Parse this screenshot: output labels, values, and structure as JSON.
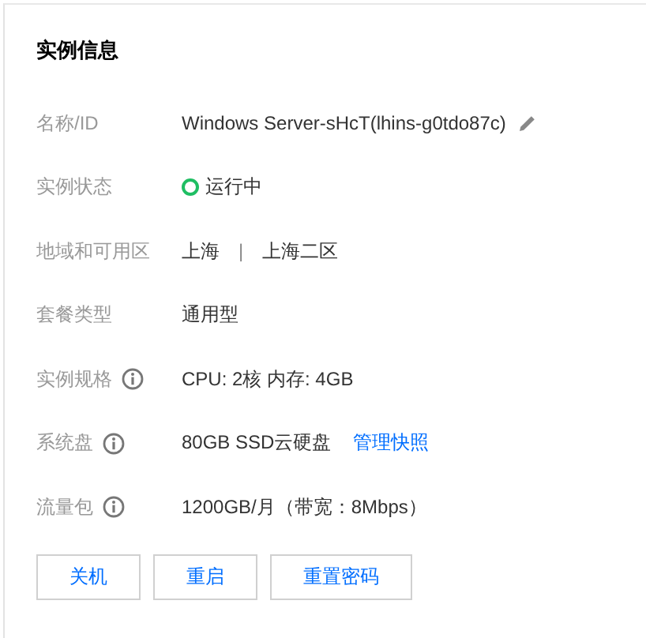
{
  "panel": {
    "title": "实例信息"
  },
  "rows": [
    {
      "kind": "edit",
      "label": "名称/ID",
      "info": false,
      "value": "Windows Server-sHcT(lhins-g0tdo87c)"
    },
    {
      "kind": "status",
      "label": "实例状态",
      "info": false,
      "value": "运行中",
      "color": "#1fbe63"
    },
    {
      "kind": "region",
      "label": "地域和可用区",
      "info": false,
      "value": "上海",
      "separator": "|",
      "value_2": "上海二区"
    },
    {
      "kind": "text",
      "label": "套餐类型",
      "info": false,
      "value": "通用型"
    },
    {
      "kind": "text",
      "label": "实例规格",
      "info": true,
      "value": "CPU: 2核 内存: 4GB"
    },
    {
      "kind": "link",
      "label": "系统盘",
      "info": true,
      "value": "80GB SSD云硬盘",
      "link": "管理快照"
    },
    {
      "kind": "text",
      "label": "流量包",
      "info": true,
      "value": "1200GB/月（带宽：8Mbps）"
    }
  ],
  "buttons": [
    "关机",
    "重启",
    "重置密码"
  ]
}
